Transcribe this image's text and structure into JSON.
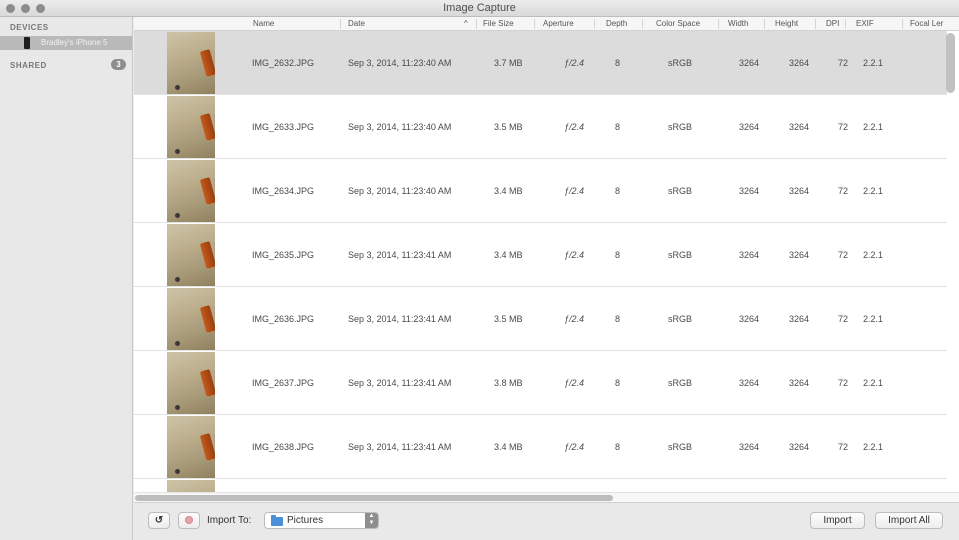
{
  "window": {
    "title": "Image Capture"
  },
  "sidebar": {
    "devices_heading": "DEVICES",
    "device_name": "Bradley's iPhone 5",
    "shared_heading": "SHARED",
    "shared_count": "3"
  },
  "table": {
    "columns": [
      "Name",
      "Date",
      "File Size",
      "Aperture",
      "Depth",
      "Color Space",
      "Width",
      "Height",
      "DPI",
      "EXIF",
      "Focal Ler"
    ],
    "sort_indicator": "^",
    "rows": [
      {
        "name": "IMG_2632.JPG",
        "date": "Sep 3, 2014, 11:23:40 AM",
        "size": "3.7 MB",
        "aperture": "ƒ/2.4",
        "depth": "8",
        "color_space": "sRGB",
        "width": "3264",
        "height": "3264",
        "dpi": "72",
        "exif": "2.2.1"
      },
      {
        "name": "IMG_2633.JPG",
        "date": "Sep 3, 2014, 11:23:40 AM",
        "size": "3.5 MB",
        "aperture": "ƒ/2.4",
        "depth": "8",
        "color_space": "sRGB",
        "width": "3264",
        "height": "3264",
        "dpi": "72",
        "exif": "2.2.1"
      },
      {
        "name": "IMG_2634.JPG",
        "date": "Sep 3, 2014, 11:23:40 AM",
        "size": "3.4 MB",
        "aperture": "ƒ/2.4",
        "depth": "8",
        "color_space": "sRGB",
        "width": "3264",
        "height": "3264",
        "dpi": "72",
        "exif": "2.2.1"
      },
      {
        "name": "IMG_2635.JPG",
        "date": "Sep 3, 2014, 11:23:41 AM",
        "size": "3.4 MB",
        "aperture": "ƒ/2.4",
        "depth": "8",
        "color_space": "sRGB",
        "width": "3264",
        "height": "3264",
        "dpi": "72",
        "exif": "2.2.1"
      },
      {
        "name": "IMG_2636.JPG",
        "date": "Sep 3, 2014, 11:23:41 AM",
        "size": "3.5 MB",
        "aperture": "ƒ/2.4",
        "depth": "8",
        "color_space": "sRGB",
        "width": "3264",
        "height": "3264",
        "dpi": "72",
        "exif": "2.2.1"
      },
      {
        "name": "IMG_2637.JPG",
        "date": "Sep 3, 2014, 11:23:41 AM",
        "size": "3.8 MB",
        "aperture": "ƒ/2.4",
        "depth": "8",
        "color_space": "sRGB",
        "width": "3264",
        "height": "3264",
        "dpi": "72",
        "exif": "2.2.1"
      },
      {
        "name": "IMG_2638.JPG",
        "date": "Sep 3, 2014, 11:23:41 AM",
        "size": "3.4 MB",
        "aperture": "ƒ/2.4",
        "depth": "8",
        "color_space": "sRGB",
        "width": "3264",
        "height": "3264",
        "dpi": "72",
        "exif": "2.2.1"
      }
    ],
    "selected_row": 0
  },
  "bottombar": {
    "rotate_label": "↺",
    "import_to_label": "Import To:",
    "destination": "Pictures",
    "import_label": "Import",
    "import_all_label": "Import All"
  },
  "icons": [
    "close-icon",
    "minimize-icon",
    "zoom-icon",
    "iphone-icon",
    "rotate-icon",
    "delete-icon",
    "folder-icon",
    "select-arrows-icon"
  ]
}
